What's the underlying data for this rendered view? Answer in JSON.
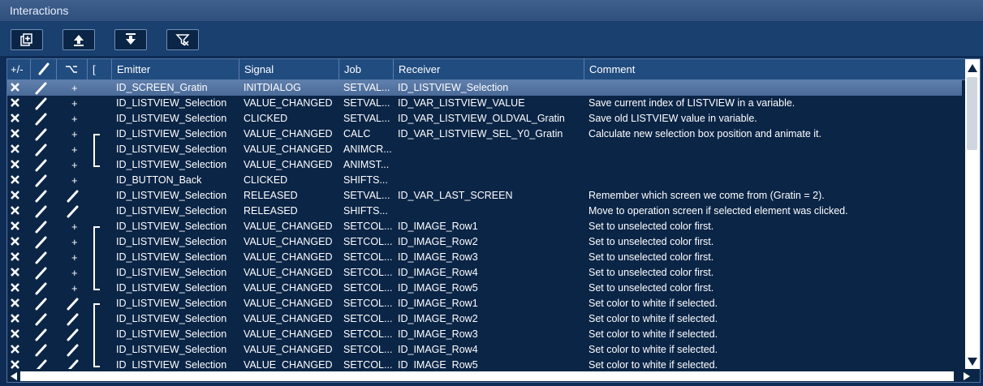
{
  "window": {
    "title": "Interactions"
  },
  "toolbar": {
    "buttons": [
      {
        "icon": "copy-add-icon"
      },
      {
        "icon": "move-up-icon"
      },
      {
        "icon": "move-down-icon"
      },
      {
        "icon": "filter-icon"
      }
    ]
  },
  "columns": {
    "add_remove": "+/-",
    "edit": "edit-icon",
    "condition": "condition-icon",
    "bracket": "[",
    "emitter": "Emitter",
    "signal": "Signal",
    "job": "Job",
    "receiver": "Receiver",
    "comment": "Comment"
  },
  "rows": [
    {
      "selected": true,
      "cond": "+",
      "bracket": "",
      "emitter": "ID_SCREEN_Gratin",
      "signal": "INITDIALOG",
      "job": "SETVAL...",
      "receiver": "ID_LISTVIEW_Selection",
      "comment": ""
    },
    {
      "selected": false,
      "cond": "+",
      "bracket": "",
      "emitter": "ID_LISTVIEW_Selection",
      "signal": "VALUE_CHANGED",
      "job": "SETVAL...",
      "receiver": "ID_VAR_LISTVIEW_VALUE",
      "comment": "Save current index of LISTVIEW in a variable."
    },
    {
      "selected": false,
      "cond": "+",
      "bracket": "",
      "emitter": "ID_LISTVIEW_Selection",
      "signal": "CLICKED",
      "job": "SETVAL...",
      "receiver": "ID_VAR_LISTVIEW_OLDVAL_Gratin",
      "comment": "Save old LISTVIEW value in variable."
    },
    {
      "selected": false,
      "cond": "+",
      "bracket": "start",
      "emitter": "ID_LISTVIEW_Selection",
      "signal": "VALUE_CHANGED",
      "job": "CALC",
      "receiver": "ID_VAR_LISTVIEW_SEL_Y0_Gratin",
      "comment": "Calculate new selection box position and animate it."
    },
    {
      "selected": false,
      "cond": "+",
      "bracket": "mid",
      "emitter": "ID_LISTVIEW_Selection",
      "signal": "VALUE_CHANGED",
      "job": "ANIMCR...",
      "receiver": "",
      "comment": ""
    },
    {
      "selected": false,
      "cond": "+",
      "bracket": "end",
      "emitter": "ID_LISTVIEW_Selection",
      "signal": "VALUE_CHANGED",
      "job": "ANIMST...",
      "receiver": "",
      "comment": ""
    },
    {
      "selected": false,
      "cond": "+",
      "bracket": "",
      "emitter": "ID_BUTTON_Back",
      "signal": "CLICKED",
      "job": "SHIFTS...",
      "receiver": "",
      "comment": ""
    },
    {
      "selected": false,
      "cond": "edit",
      "bracket": "",
      "emitter": "ID_LISTVIEW_Selection",
      "signal": "RELEASED",
      "job": "SETVAL...",
      "receiver": "ID_VAR_LAST_SCREEN",
      "comment": "Remember which screen we come from (Gratin = 2)."
    },
    {
      "selected": false,
      "cond": "edit",
      "bracket": "",
      "emitter": "ID_LISTVIEW_Selection",
      "signal": "RELEASED",
      "job": "SHIFTS...",
      "receiver": "",
      "comment": "Move to operation screen if selected element was clicked."
    },
    {
      "selected": false,
      "cond": "+",
      "bracket": "start",
      "emitter": "ID_LISTVIEW_Selection",
      "signal": "VALUE_CHANGED",
      "job": "SETCOL...",
      "receiver": "ID_IMAGE_Row1",
      "comment": "Set to unselected color first."
    },
    {
      "selected": false,
      "cond": "+",
      "bracket": "mid",
      "emitter": "ID_LISTVIEW_Selection",
      "signal": "VALUE_CHANGED",
      "job": "SETCOL...",
      "receiver": "ID_IMAGE_Row2",
      "comment": "Set to unselected color first."
    },
    {
      "selected": false,
      "cond": "+",
      "bracket": "mid",
      "emitter": "ID_LISTVIEW_Selection",
      "signal": "VALUE_CHANGED",
      "job": "SETCOL...",
      "receiver": "ID_IMAGE_Row3",
      "comment": "Set to unselected color first."
    },
    {
      "selected": false,
      "cond": "+",
      "bracket": "mid",
      "emitter": "ID_LISTVIEW_Selection",
      "signal": "VALUE_CHANGED",
      "job": "SETCOL...",
      "receiver": "ID_IMAGE_Row4",
      "comment": "Set to unselected color first."
    },
    {
      "selected": false,
      "cond": "+",
      "bracket": "end",
      "emitter": "ID_LISTVIEW_Selection",
      "signal": "VALUE_CHANGED",
      "job": "SETCOL...",
      "receiver": "ID_IMAGE_Row5",
      "comment": "Set to unselected color first."
    },
    {
      "selected": false,
      "cond": "edit",
      "bracket": "start",
      "emitter": "ID_LISTVIEW_Selection",
      "signal": "VALUE_CHANGED",
      "job": "SETCOL...",
      "receiver": "ID_IMAGE_Row1",
      "comment": "Set color to white if selected."
    },
    {
      "selected": false,
      "cond": "edit",
      "bracket": "mid",
      "emitter": "ID_LISTVIEW_Selection",
      "signal": "VALUE_CHANGED",
      "job": "SETCOL...",
      "receiver": "ID_IMAGE_Row2",
      "comment": "Set color to white if selected."
    },
    {
      "selected": false,
      "cond": "edit",
      "bracket": "mid",
      "emitter": "ID_LISTVIEW_Selection",
      "signal": "VALUE_CHANGED",
      "job": "SETCOL...",
      "receiver": "ID_IMAGE_Row3",
      "comment": "Set color to white if selected."
    },
    {
      "selected": false,
      "cond": "edit",
      "bracket": "mid",
      "emitter": "ID_LISTVIEW_Selection",
      "signal": "VALUE_CHANGED",
      "job": "SETCOL...",
      "receiver": "ID_IMAGE_Row4",
      "comment": "Set color to white if selected."
    },
    {
      "selected": false,
      "cond": "edit",
      "bracket": "end",
      "emitter": "ID_LISTVIEW_Selection",
      "signal": "VALUE_CHANGED",
      "job": "SETCOL...",
      "receiver": "ID_IMAGE_Row5",
      "comment": "Set color to white if selected."
    }
  ],
  "colors": {
    "background": "#0e2c55",
    "header": "#214c7f",
    "selected_row": "#5576a4",
    "text": "#ffffff"
  }
}
